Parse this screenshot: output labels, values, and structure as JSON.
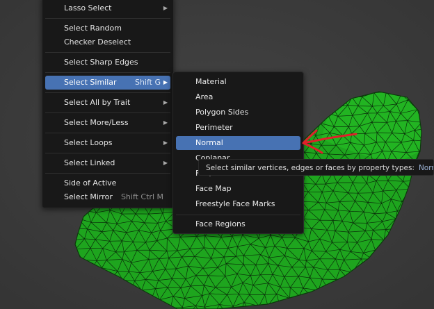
{
  "select_menu": {
    "items": [
      {
        "label": "Lasso Select",
        "shortcut": ""
      },
      {
        "label": "Select Random",
        "shortcut": ""
      },
      {
        "label": "Checker Deselect",
        "shortcut": ""
      },
      {
        "label": "Select Sharp Edges",
        "shortcut": ""
      },
      {
        "label": "Select Similar",
        "shortcut": "Shift G"
      },
      {
        "label": "Select All by Trait",
        "shortcut": ""
      },
      {
        "label": "Select More/Less",
        "shortcut": ""
      },
      {
        "label": "Select Loops",
        "shortcut": ""
      },
      {
        "label": "Select Linked",
        "shortcut": ""
      },
      {
        "label": "Side of Active",
        "shortcut": ""
      },
      {
        "label": "Select Mirror",
        "shortcut": "Shift Ctrl M"
      }
    ]
  },
  "similar_menu": {
    "items": [
      {
        "label": "Material"
      },
      {
        "label": "Area"
      },
      {
        "label": "Polygon Sides"
      },
      {
        "label": "Perimeter"
      },
      {
        "label": "Normal"
      },
      {
        "label": "Coplanar"
      },
      {
        "label": "Flat/Smooth"
      },
      {
        "label": "Face Map"
      },
      {
        "label": "Freestyle Face Marks"
      },
      {
        "label": "Face Regions"
      }
    ]
  },
  "tooltip": {
    "text": "Select similar vertices, edges or faces by property types:",
    "value": "Normal"
  },
  "colors": {
    "viewport_background": "#3d3d3d",
    "mesh_fill": "#1ea51e",
    "mesh_wire": "#0a2e0a",
    "menu_background": "#181818",
    "highlight": "#4772b3",
    "annotation_arrow": "#e0202a"
  },
  "icons": [
    "chevron-right-icon",
    "annotation-arrow-icon"
  ]
}
